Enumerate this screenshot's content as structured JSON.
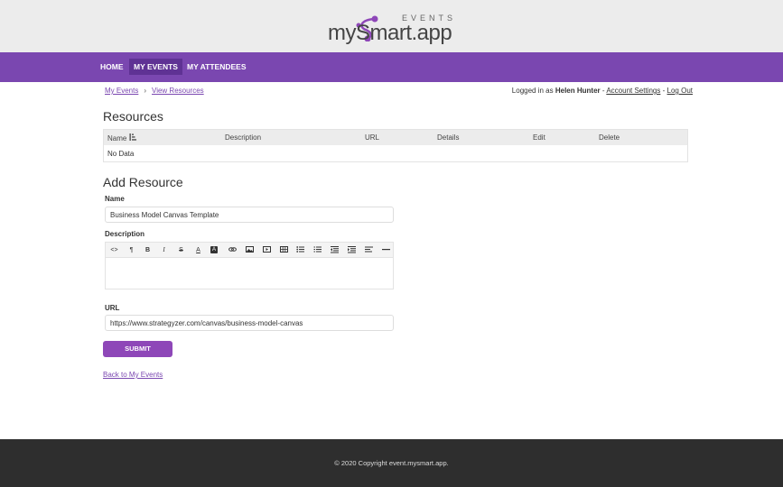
{
  "logo": {
    "events": "EVENTS",
    "text": "mySmart.app"
  },
  "nav": {
    "items": [
      {
        "label": "HOME"
      },
      {
        "label": "MY EVENTS"
      },
      {
        "label": "MY ATTENDEES"
      }
    ],
    "active": "MY EVENTS"
  },
  "breadcrumb": {
    "items": [
      "My Events",
      "View Resources"
    ],
    "separator": "›"
  },
  "session": {
    "prefix": "Logged in as",
    "user": "Helen Hunter",
    "dash1": "-",
    "account_settings": "Account Settings",
    "dash2": "-",
    "logout": "Log Out"
  },
  "resources": {
    "title": "Resources",
    "columns": [
      "Name",
      "Description",
      "URL",
      "Details",
      "Edit",
      "Delete"
    ],
    "empty": "No Data"
  },
  "add_resource": {
    "title": "Add Resource",
    "name_label": "Name",
    "name_value": "Business Model Canvas Template",
    "description_label": "Description",
    "toolbar_icons": [
      "code-view-icon",
      "paragraph-icon",
      "bold-icon",
      "italic-icon",
      "strikethrough-icon",
      "font-color-icon",
      "background-color-icon",
      "link-icon",
      "image-icon",
      "video-icon",
      "table-icon",
      "bullet-list-icon",
      "numbered-list-icon",
      "outdent-icon",
      "indent-icon",
      "align-icon",
      "horizontal-rule-icon"
    ],
    "url_label": "URL",
    "url_value": "https://www.strategyzer.com/canvas/business-model-canvas",
    "submit_label": "SUBMIT"
  },
  "back_link": "Back to My Events",
  "footer": {
    "copyright": "© 2020 Copyright event.mysmart.app."
  },
  "colors": {
    "brand": "#7a47b0",
    "nav_active": "#5f3294",
    "button": "#8e47b8",
    "footer": "#2e2e2e"
  }
}
